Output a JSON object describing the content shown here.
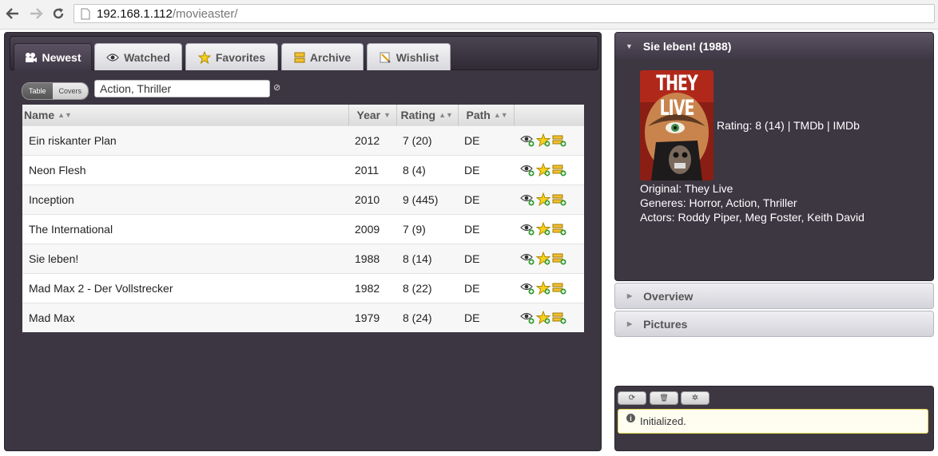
{
  "browser": {
    "url_host": "192.168.1.112",
    "url_path": "/movieaster/"
  },
  "tabs": [
    {
      "label": "Newest",
      "icon": "tv-icon",
      "active": true
    },
    {
      "label": "Watched",
      "icon": "eye-icon",
      "active": false
    },
    {
      "label": "Favorites",
      "icon": "star-icon",
      "active": false
    },
    {
      "label": "Archive",
      "icon": "archive-icon",
      "active": false
    },
    {
      "label": "Wishlist",
      "icon": "wishlist-icon",
      "active": false
    }
  ],
  "view_toggle": {
    "table": "Table",
    "covers": "Covers",
    "selected": "Table"
  },
  "filter": {
    "value": "Action, Thriller",
    "clear_icon": "clear-icon"
  },
  "table": {
    "columns": [
      {
        "label": "Name",
        "sort": "both"
      },
      {
        "label": "Year",
        "sort": "desc"
      },
      {
        "label": "Rating",
        "sort": "both"
      },
      {
        "label": "Path",
        "sort": "both"
      },
      {
        "label": "",
        "sort": "none"
      }
    ],
    "rows": [
      {
        "name": "Ein riskanter Plan",
        "year": "2012",
        "rating": "7 (20)",
        "path": "DE"
      },
      {
        "name": "Neon Flesh",
        "year": "2011",
        "rating": "8 (4)",
        "path": "DE"
      },
      {
        "name": "Inception",
        "year": "2010",
        "rating": "9 (445)",
        "path": "DE"
      },
      {
        "name": "The International",
        "year": "2009",
        "rating": "7 (9)",
        "path": "DE"
      },
      {
        "name": "Sie leben!",
        "year": "1988",
        "rating": "8 (14)",
        "path": "DE"
      },
      {
        "name": "Mad Max 2 - Der Vollstrecker",
        "year": "1982",
        "rating": "8 (22)",
        "path": "DE"
      },
      {
        "name": "Mad Max",
        "year": "1979",
        "rating": "8 (24)",
        "path": "DE"
      }
    ],
    "row_action_icons": [
      "watched-eye-icon",
      "favorite-star-icon",
      "archive-add-icon"
    ]
  },
  "detail": {
    "title": "Sie leben! (1988)",
    "poster_text": "THEY LIVE",
    "rating": "Rating: 8 (14) | TMDb | IMDb",
    "original": "Original: They Live",
    "genres": "Generes: Horror, Action, Thriller",
    "actors": "Actors: Roddy Piper, Meg Foster, Keith David"
  },
  "accordion": {
    "overview": "Overview",
    "pictures": "Pictures"
  },
  "log": {
    "buttons": [
      {
        "icon": "refresh-icon",
        "glyph": "⟳"
      },
      {
        "icon": "trash-icon",
        "glyph": "🗑"
      },
      {
        "icon": "settings-icon",
        "glyph": "✲"
      }
    ],
    "message": "Initialized."
  },
  "colors": {
    "panel_bg": "#3c3642",
    "tab_active": "#4a4250",
    "log_border": "#e5d24c"
  }
}
